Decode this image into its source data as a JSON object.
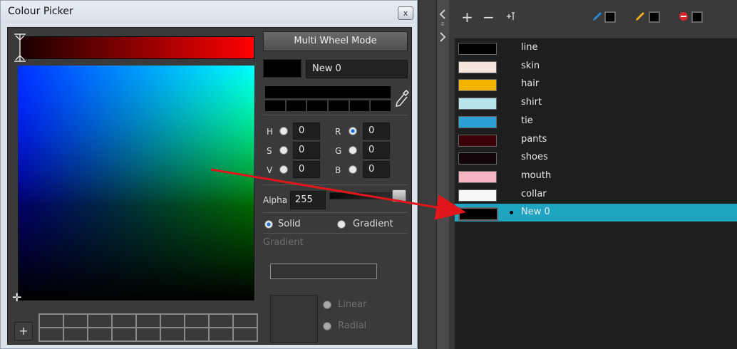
{
  "window": {
    "title": "Colour Picker",
    "close_glyph": "x"
  },
  "picker": {
    "mode_button": "Multi Wheel Mode",
    "color_name": "New 0",
    "hsv": [
      {
        "label": "H",
        "value": "0"
      },
      {
        "label": "S",
        "value": "0"
      },
      {
        "label": "V",
        "value": "0"
      }
    ],
    "rgb": [
      {
        "label": "R",
        "value": "0"
      },
      {
        "label": "G",
        "value": "0"
      },
      {
        "label": "B",
        "value": "0"
      }
    ],
    "alpha_label": "Alpha",
    "alpha_value": "255",
    "solid_label": "Solid",
    "gradient_label": "Gradient",
    "gradient_section": "Gradient",
    "linear_label": "Linear",
    "radial_label": "Radial",
    "add_swatch": "+",
    "selected_model": "R",
    "fill_type": "Solid"
  },
  "palette_toolbar": {
    "add": "+",
    "remove": "−",
    "icons": [
      "add-colour-icon",
      "remove-colour-icon",
      "tint-icon",
      "pencil-icon",
      "brush-icon",
      "texture-icon"
    ]
  },
  "palette": [
    {
      "name": "line",
      "color": "#000000"
    },
    {
      "name": "skin",
      "color": "#f4e6dc"
    },
    {
      "name": "hair",
      "color": "#f5b400"
    },
    {
      "name": "shirt",
      "color": "#b8e4ec"
    },
    {
      "name": "tie",
      "color": "#2aa0d6"
    },
    {
      "name": "pants",
      "color": "#3b0008"
    },
    {
      "name": "shoes",
      "color": "#120508"
    },
    {
      "name": "mouth",
      "color": "#f6b7c2"
    },
    {
      "name": "collar",
      "color": "#f8f8f8"
    },
    {
      "name": "New 0",
      "color": "#000000",
      "selected": true
    }
  ],
  "colors": {
    "accent": "#1fa4c1",
    "arrow": "#e0161a"
  }
}
